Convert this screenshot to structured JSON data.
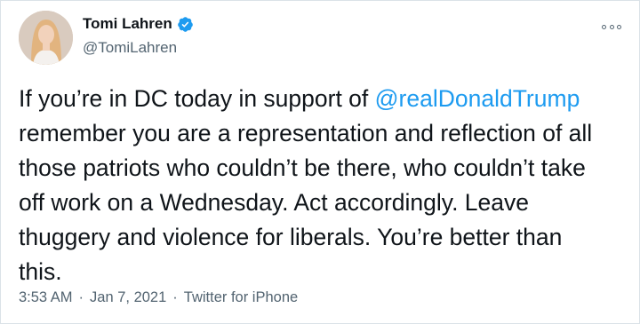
{
  "author": {
    "name": "Tomi Lahren",
    "handle": "@TomiLahren",
    "verified": true
  },
  "tweet": {
    "text_before": "If you’re in DC today in support of ",
    "mention": "@realDonaldTrump",
    "text_after": "\nremember you are a representation and reflection of all\nthose patriots who couldn’t be there, who couldn’t take\noff work on a Wednesday. Act accordingly. Leave\nthuggery and violence for liberals. You’re better than\nthis."
  },
  "meta": {
    "time": "3:53 AM",
    "date": "Jan 7, 2021",
    "source": "Twitter for iPhone",
    "separator": "·"
  },
  "colors": {
    "mention": "#1d9bf0",
    "verified_badge": "#1d9bf0",
    "secondary_text": "#536471"
  },
  "icons": {
    "verified": "verified-badge-icon",
    "more": "more-options-icon"
  }
}
